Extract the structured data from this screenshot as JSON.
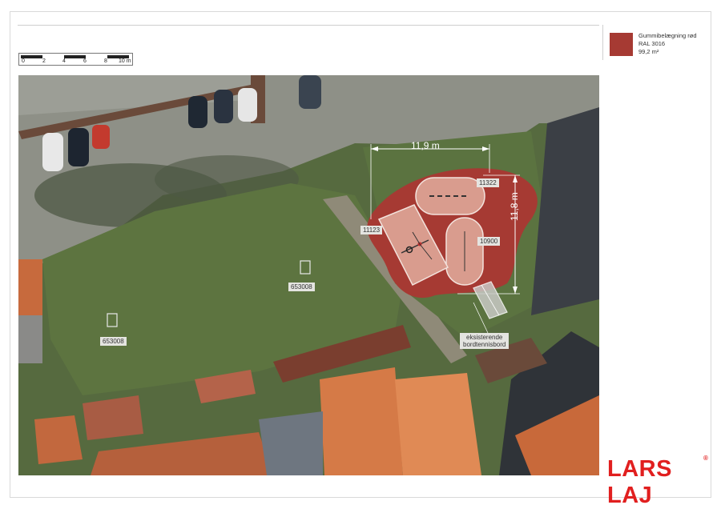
{
  "scale": {
    "ticks": [
      "0",
      "2",
      "4",
      "6",
      "8",
      "10 m"
    ]
  },
  "legend": {
    "name": "Gummibelægning rød",
    "ral": "RAL 3016",
    "area": "99,2 m²",
    "color": "#a63a33"
  },
  "plan": {
    "width_dim": "11,9 m",
    "height_dim": "11,8 m",
    "products": [
      "11322",
      "11123",
      "10900"
    ],
    "lawn_items": [
      "653008",
      "653008"
    ],
    "existing_label": [
      "eksisterende",
      "bordtennisbord"
    ]
  },
  "logo": {
    "text": "LARS LAJ",
    "mark": "®"
  }
}
